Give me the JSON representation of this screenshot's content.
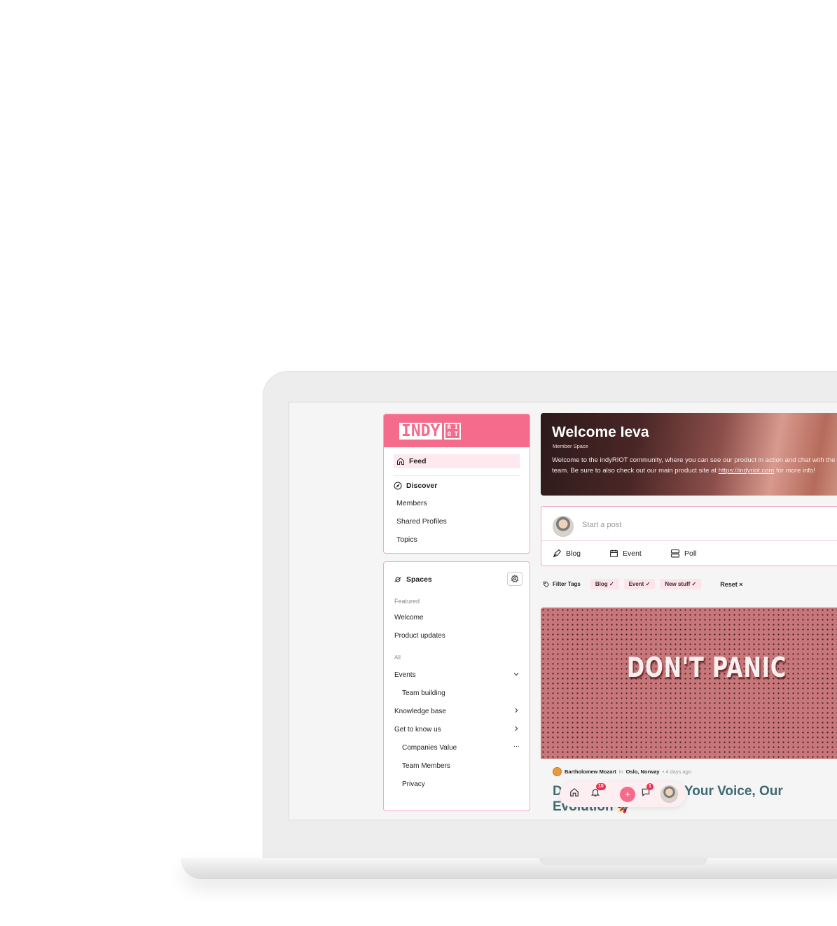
{
  "brand": {
    "logo_main": "INDY",
    "logo_grid": [
      "R",
      "I",
      "O",
      "T"
    ]
  },
  "nav": {
    "feed": "Feed",
    "discover": "Discover",
    "members": "Members",
    "shared_profiles": "Shared Profiles",
    "topics": "Topics"
  },
  "spaces": {
    "title": "Spaces",
    "featured_label": "Featured",
    "featured": [
      "Welcome",
      "Product updates"
    ],
    "all_label": "All",
    "items": [
      {
        "label": "Events",
        "chevron": "chevron-down-icon"
      },
      {
        "label": "Team building"
      },
      {
        "label": "Knowledge base",
        "chevron": "chevron-right-icon"
      },
      {
        "label": "Get to know us",
        "chevron": "chevron-right-icon"
      },
      {
        "label": "Companies Value",
        "menu": "···"
      },
      {
        "label": "Team Members"
      },
      {
        "label": "Privacy"
      }
    ]
  },
  "banner": {
    "title": "Welcome Ieva",
    "subtitle": "Member Space",
    "text_before": "Welcome to the indyRIOT community, where you can see our product in action and chat with the team. Be sure to also check out our main product site at ",
    "link": "https://indyriot.com",
    "text_after": " for more info!"
  },
  "composer": {
    "placeholder": "Start a post",
    "types": [
      "Blog",
      "Event",
      "Poll"
    ]
  },
  "filters": {
    "label": "Filter Tags",
    "chips": [
      "Blog ✓",
      "Event ✓",
      "New stuff ✓"
    ],
    "reset": "Reset ×"
  },
  "post": {
    "image_text": "DON'T PANIC",
    "author": "Bartholomew Mozart",
    "in": "in",
    "location": "Oslo, Norway",
    "time": "• 4 days ago",
    "title_start": "D",
    "title_right": "Your Voice, Our",
    "title_line2": "Evolution 🚀"
  },
  "dock": {
    "notifications_count": "10",
    "messages_count": "1",
    "plus": "+"
  },
  "colors": {
    "accent": "#f56b8c",
    "accent_light": "#fde9ee",
    "title_teal": "#3f6972"
  }
}
